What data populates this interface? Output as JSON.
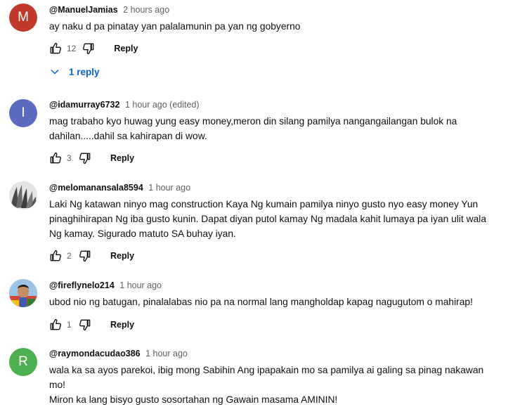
{
  "comments": [
    {
      "author": "@ManuelJamias",
      "time": "2 hours ago",
      "lines": [
        "ay naku d pa pinatay yan palalamunin pa yan ng gobyerno"
      ],
      "likes": "12",
      "reply_label": "Reply",
      "avatar_letter": "M",
      "avatar_color": "#c0392b",
      "replies_label": "1 reply"
    },
    {
      "author": "@idamurray6732",
      "time": "1 hour ago (edited)",
      "lines": [
        "mag trabaho kyo huwag yung easy money,meron din silang pamilya nangangailangan bulok na",
        "dahilan.....dahil sa kahirapan  di wow."
      ],
      "likes": "3",
      "reply_label": "Reply",
      "avatar_letter": "I",
      "avatar_color": "#5c6bc0"
    },
    {
      "author": "@melomanansala8594",
      "time": "1 hour ago",
      "lines": [
        "Laki Ng katawan ninyo mag construction Kaya Ng kumain pamilya ninyo gusto nyo easy money Yun",
        "pinaghihirapan Ng iba gusto kunin. Dapat diyan putol kamay Ng madala kahit lumaya pa iyan ulit wala",
        "Ng kamay. Sigurado matuto SA buhay iyan."
      ],
      "likes": "2",
      "reply_label": "Reply"
    },
    {
      "author": "@fireflynelo214",
      "time": "1 hour ago",
      "lines": [
        "ubod nio ng batugan, pinalalabas nio pa na normal lang mangholdap kapag nagugutom o mahirap!"
      ],
      "likes": "1",
      "reply_label": "Reply"
    },
    {
      "author": "@raymondacudao386",
      "time": "1 hour ago",
      "lines": [
        "wala ka sa ayos parekoi, ibig mong Sabihin Ang ipapakain mo sa pamilya ai galing sa pinag nakawan",
        "mo!",
        "Miron ka lang bisyo gusto sosortahan ng Gawain masama AMININ!"
      ],
      "avatar_letter": "R",
      "avatar_color": "#4caf50"
    }
  ],
  "icons": {
    "like": "thumb-up-icon",
    "dislike": "thumb-down-icon",
    "expand": "chevron-down-icon"
  },
  "colors": {
    "link_blue": "#065fd4",
    "secondary_text": "#606060"
  }
}
